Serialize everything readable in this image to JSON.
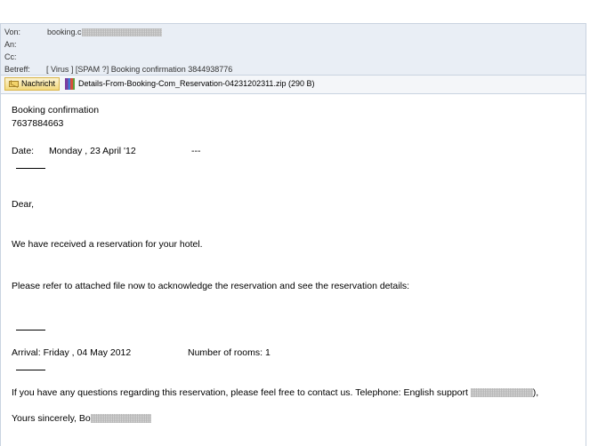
{
  "header": {
    "from_label": "Von:",
    "from_value": "booking.c",
    "to_label": "An:",
    "cc_label": "Cc:",
    "subject_label": "Betreff:",
    "subject_value": "[ Virus ] [SPAM ?] Booking confirmation  3844938776"
  },
  "tabs": {
    "message_label": "Nachricht",
    "attachment_label": "Details-From-Booking-Com_Reservation-04231202311.zip (290 B)"
  },
  "body": {
    "line1": "Booking confirmation",
    "line2": "7637884663",
    "date_label": "Date:",
    "date_value": "Monday , 23 April '12",
    "date_dashes": "---",
    "dear": "Dear,",
    "received": "We have received a reservation for your hotel.",
    "refer": "Please refer to attached file now to acknowledge the reservation and see the reservation details:",
    "arrival": "Arrival: Friday , 04 May 2012",
    "rooms": "Number of rooms: 1",
    "questions": "If you have any questions regarding this reservation, please feel free to contact us. Telephone: English support",
    "questions_end": "),",
    "yours": "Yours sincerely, Bo"
  }
}
